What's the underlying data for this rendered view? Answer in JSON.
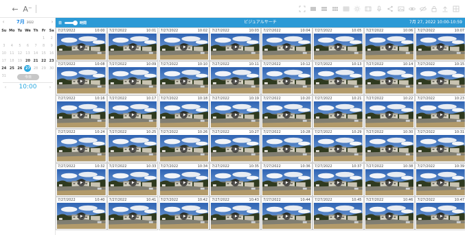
{
  "toolbar": {
    "back_glyph": "←",
    "forward_label": "A⁻",
    "icons": [
      "expand-icon",
      "layout-1-icon",
      "layout-2-icon",
      "layout-3-icon",
      "layout-4-icon",
      "brightness-icon",
      "film-icon",
      "mic-icon",
      "share-icon",
      "image-icon",
      "eye-icon",
      "eye-off-icon",
      "lock-icon",
      "upload-icon",
      "grid-icon"
    ]
  },
  "calendar": {
    "month_label": "7月",
    "year_label": "2022",
    "prev_glyph": "‹",
    "next_glyph": "›",
    "weekdays": [
      "Su",
      "Mo",
      "Tu",
      "We",
      "Th",
      "Fr",
      "Sa"
    ],
    "weeks": [
      [
        "",
        "",
        "",
        "",
        "",
        "1",
        "2"
      ],
      [
        "3",
        "4",
        "5",
        "6",
        "7",
        "8",
        "9"
      ],
      [
        "10",
        "11",
        "12",
        "13",
        "14",
        "15",
        "16"
      ],
      [
        "17",
        "18",
        "19",
        "20",
        "21",
        "22",
        "23"
      ],
      [
        "24",
        "25",
        "26",
        "27",
        "28",
        "29",
        "30"
      ],
      [
        "31",
        "",
        "",
        "",
        "",
        "",
        ""
      ]
    ],
    "recorded_days": [
      "20",
      "21",
      "22",
      "23",
      "24",
      "25",
      "26",
      "27"
    ],
    "selected_day": "27"
  },
  "time_picker": {
    "today_label": "今日",
    "time": "10:00",
    "prev_glyph": "‹",
    "next_glyph": "›"
  },
  "header": {
    "toggle_left": "日",
    "toggle_right": "時間",
    "title": "ビジュアルサーチ",
    "range": "7月 27, 2022 10:00-10:59"
  },
  "thumbnails": {
    "date": "7/27/2022",
    "times": [
      "10:00",
      "10:01",
      "10:02",
      "10:03",
      "10:04",
      "10:05",
      "10:06",
      "10:07",
      "10:08",
      "10:09",
      "10:10",
      "10:11",
      "10:12",
      "10:13",
      "10:14",
      "10:15",
      "10:16",
      "10:17",
      "10:18",
      "10:19",
      "10:20",
      "10:21",
      "10:22",
      "10:23",
      "10:24",
      "10:25",
      "10:26",
      "10:27",
      "10:28",
      "10:29",
      "10:30",
      "10:31",
      "10:32",
      "10:33",
      "10:34",
      "10:35",
      "10:36",
      "10:37",
      "10:38",
      "10:39",
      "10:40",
      "10:41",
      "10:42",
      "10:43",
      "10:44",
      "10:45",
      "10:46",
      "10:47"
    ]
  },
  "colors": {
    "accent": "#2b9ad6",
    "selected_day": "#29a8e0"
  }
}
